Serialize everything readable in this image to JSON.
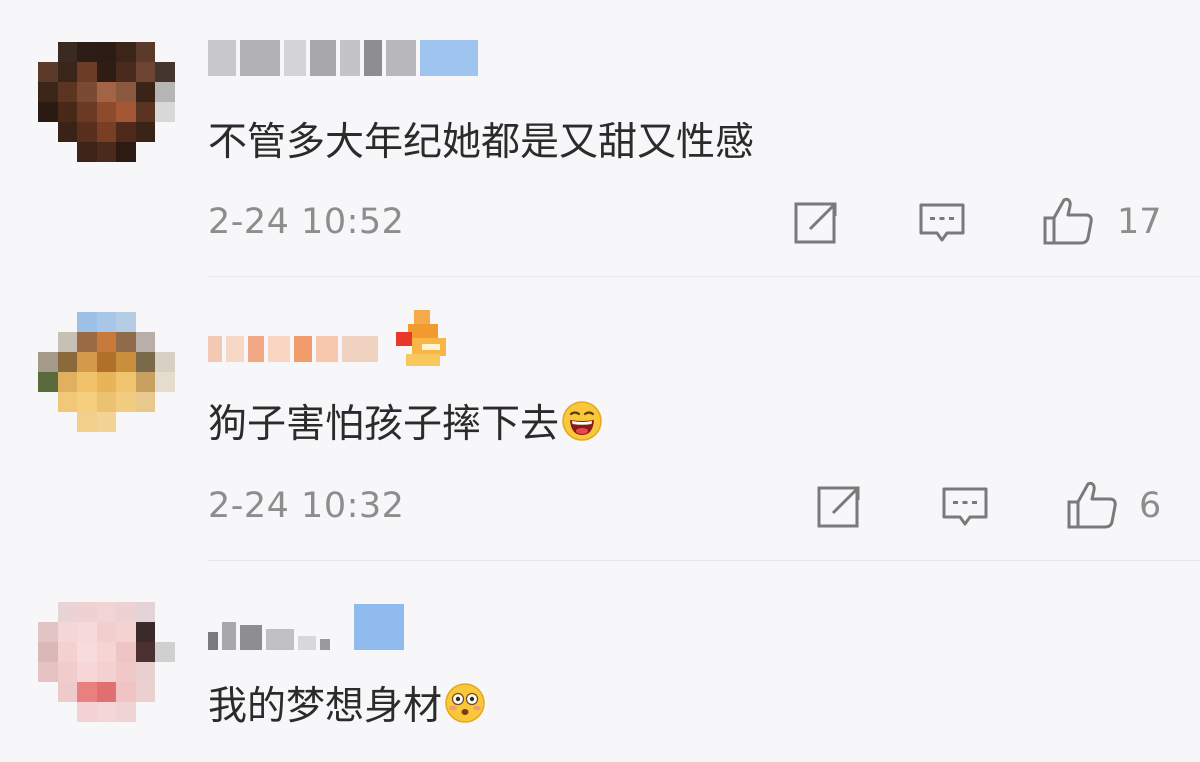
{
  "comments": [
    {
      "text": "不管多大年纪她都是又甜又性感",
      "time": "2-24 10:52",
      "likes": "17",
      "share_icon": "share-icon",
      "reply_icon": "comment-icon",
      "like_icon": "thumbs-up-icon"
    },
    {
      "text": "狗子害怕孩子摔下去",
      "emoji": "laughing-emoji",
      "time": "2-24 10:32",
      "likes": "6",
      "share_icon": "share-icon",
      "reply_icon": "comment-icon",
      "like_icon": "thumbs-up-icon"
    },
    {
      "text": "我的梦想身材",
      "emoji": "flushed-emoji"
    }
  ],
  "colors": {
    "background": "#f7f7f9",
    "text": "#2b2b2b",
    "meta": "#8d8d8d",
    "divider": "#e7e7ea"
  }
}
